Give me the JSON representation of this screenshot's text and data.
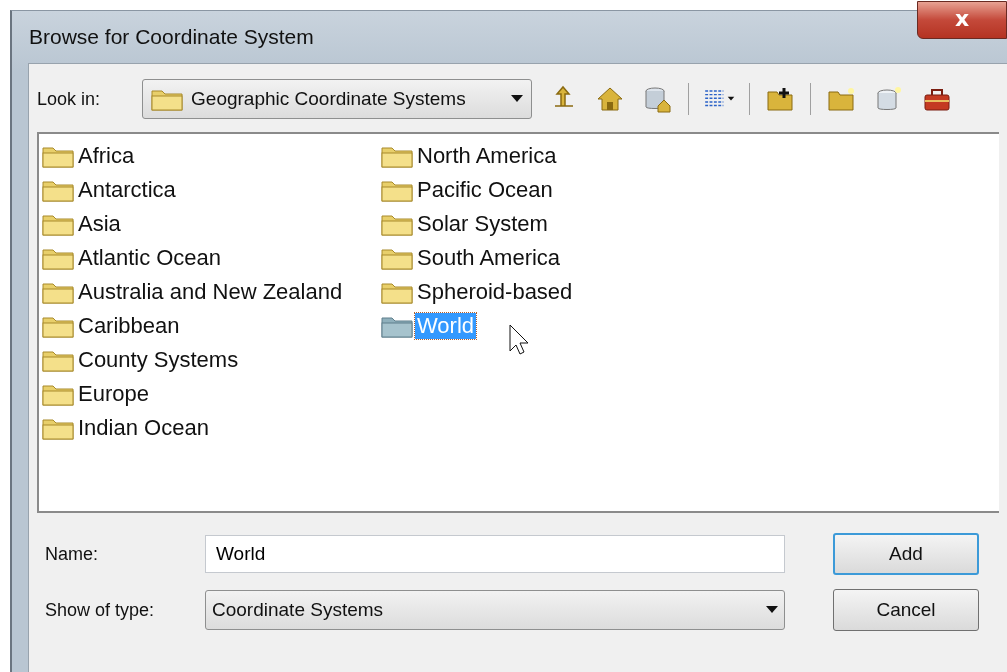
{
  "window": {
    "title": "Browse for Coordinate System",
    "close": "x"
  },
  "look_in": {
    "label": "Look in:",
    "value": "Geographic Coordinate Systems"
  },
  "items": [
    {
      "label": "Africa",
      "selected": false
    },
    {
      "label": "Antarctica",
      "selected": false
    },
    {
      "label": "Asia",
      "selected": false
    },
    {
      "label": "Atlantic Ocean",
      "selected": false
    },
    {
      "label": "Australia and New Zealand",
      "selected": false
    },
    {
      "label": "Caribbean",
      "selected": false
    },
    {
      "label": "County Systems",
      "selected": false
    },
    {
      "label": "Europe",
      "selected": false
    },
    {
      "label": "Indian Ocean",
      "selected": false
    },
    {
      "label": "North America",
      "selected": false
    },
    {
      "label": "Pacific Ocean",
      "selected": false
    },
    {
      "label": "Solar System",
      "selected": false
    },
    {
      "label": "South America",
      "selected": false
    },
    {
      "label": "Spheroid-based",
      "selected": false
    },
    {
      "label": "World",
      "selected": true
    }
  ],
  "name_field": {
    "label": "Name:",
    "value": "World"
  },
  "type_field": {
    "label": "Show of type:",
    "value": "Coordinate Systems"
  },
  "buttons": [
    {
      "label": "Add",
      "default": true
    },
    {
      "label": "Cancel",
      "default": false
    }
  ]
}
